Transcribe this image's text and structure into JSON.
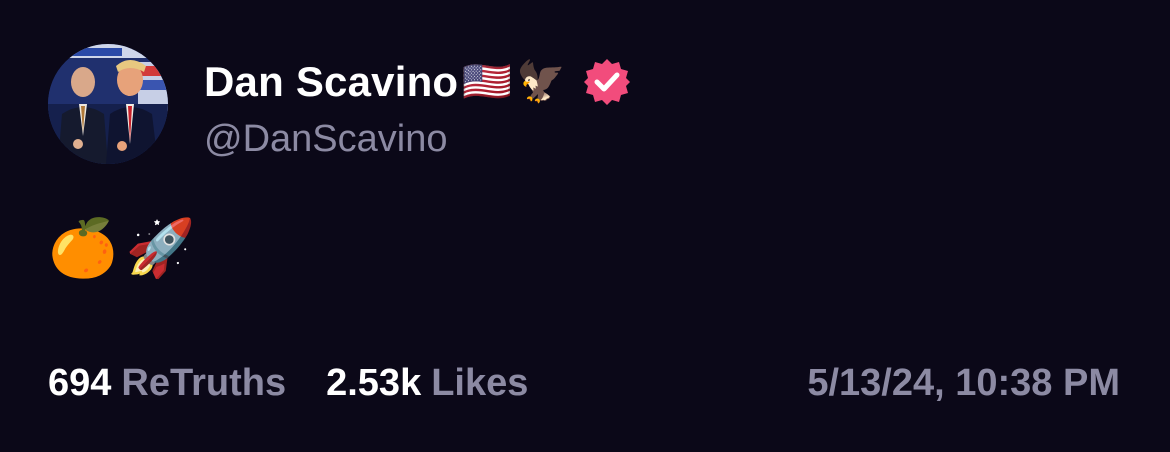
{
  "post": {
    "author": {
      "display_name": "Dan Scavino",
      "name_emojis": [
        "🇺🇸",
        "🦅"
      ],
      "handle": "@DanScavino",
      "verified": true,
      "verified_badge_color": "#f24c7c",
      "avatar_icon": "profile-photo"
    },
    "body_emojis": [
      "🍊",
      "🚀"
    ],
    "stats": {
      "retruths_count": "694",
      "retruths_label": "ReTruths",
      "likes_count": "2.53k",
      "likes_label": "Likes"
    },
    "timestamp": "5/13/24, 10:38 PM"
  },
  "colors": {
    "background": "#0b0818",
    "primary_text": "#ffffff",
    "secondary_text": "#8c8aa3",
    "accent": "#f24c7c"
  }
}
